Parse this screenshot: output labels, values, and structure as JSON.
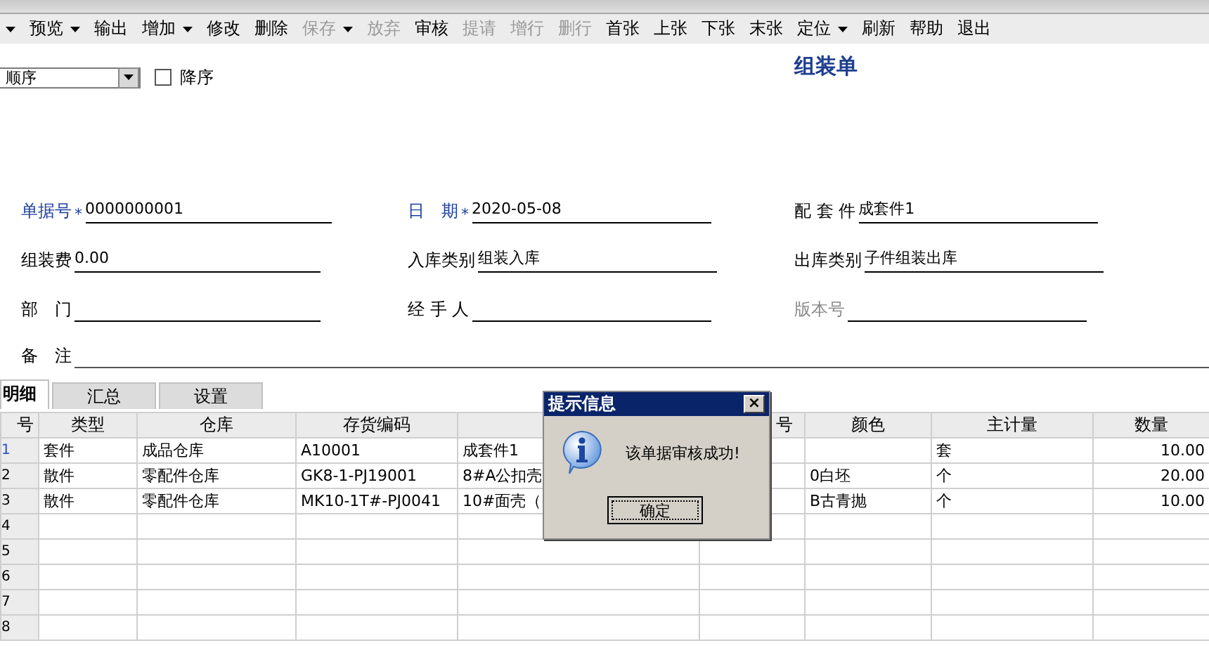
{
  "toolbar": [
    {
      "dropdown": true,
      "disabled": false
    },
    {
      "label": "预览",
      "dropdown": true,
      "disabled": false
    },
    {
      "label": "输出",
      "dropdown": false,
      "disabled": false
    },
    {
      "label": "增加",
      "dropdown": true,
      "disabled": false
    },
    {
      "label": "修改",
      "dropdown": false,
      "disabled": false
    },
    {
      "label": "删除",
      "dropdown": false,
      "disabled": false
    },
    {
      "label": "保存",
      "dropdown": true,
      "disabled": true
    },
    {
      "label": "放弃",
      "dropdown": false,
      "disabled": true
    },
    {
      "label": "审核",
      "dropdown": false,
      "disabled": false
    },
    {
      "label": "提请",
      "dropdown": false,
      "disabled": true
    },
    {
      "label": "增行",
      "dropdown": false,
      "disabled": true
    },
    {
      "label": "删行",
      "dropdown": false,
      "disabled": true
    },
    {
      "label": "首张",
      "dropdown": false,
      "disabled": false
    },
    {
      "label": "上张",
      "dropdown": false,
      "disabled": false
    },
    {
      "label": "下张",
      "dropdown": false,
      "disabled": false
    },
    {
      "label": "末张",
      "dropdown": false,
      "disabled": false
    },
    {
      "label": "定位",
      "dropdown": true,
      "disabled": false
    },
    {
      "label": "刷新",
      "dropdown": false,
      "disabled": false
    },
    {
      "label": "帮助",
      "dropdown": false,
      "disabled": false
    },
    {
      "label": "退出",
      "dropdown": false,
      "disabled": false
    }
  ],
  "sort": {
    "value": "顺序",
    "descending_label": "降序",
    "descending": false
  },
  "title": "组装单",
  "fields": [
    {
      "label": "单据号",
      "required_mark": "*",
      "value": "0000000001",
      "kind": "key",
      "disabled": false
    },
    {
      "label": "日　期",
      "required_mark": "*",
      "value": "2020-05-08",
      "kind": "key",
      "disabled": false
    },
    {
      "label": "配 套 件",
      "value": "成套件1",
      "kind": "plain",
      "disabled": false
    },
    {
      "label": "组装费",
      "value": "0.00",
      "kind": "plain",
      "disabled": false
    },
    {
      "label": "入库类别",
      "value": "组装入库",
      "kind": "plain",
      "disabled": false
    },
    {
      "label": "出库类别",
      "value": "子件组装出库",
      "kind": "plain",
      "disabled": false
    },
    {
      "label": "部　门",
      "kind": "plain",
      "disabled": false
    },
    {
      "label": "经 手 人",
      "kind": "plain",
      "disabled": false
    },
    {
      "label": "版本号",
      "kind": "plain",
      "disabled": true
    }
  ],
  "remark": {
    "label": "备　注"
  },
  "tabs": [
    {
      "label": "明细",
      "selected": true
    },
    {
      "label": "汇总",
      "selected": false
    },
    {
      "label": "设置",
      "selected": false
    }
  ],
  "table": {
    "columns": [
      "号",
      "类型",
      "仓库",
      "存货编码",
      null,
      "号",
      "颜色",
      "主计量",
      "数量"
    ],
    "rows": [
      {
        "current": true,
        "cells": [
          "1",
          "套件",
          "成品仓库",
          "A10001",
          "成套件1",
          null,
          null,
          "套",
          "10.00"
        ]
      },
      {
        "current": false,
        "cells": [
          "2",
          "散件",
          "零配件仓库",
          "GK8-1-PJ19001",
          "8#A公扣壳",
          null,
          "0白坯",
          "个",
          "20.00"
        ]
      },
      {
        "current": false,
        "cells": [
          "3",
          "散件",
          "零配件仓库",
          "MK10-1T#-PJ0041",
          "10#面壳（",
          null,
          "B古青抛",
          "个",
          "10.00"
        ]
      },
      {
        "current": false,
        "cells": [
          "4",
          null,
          null,
          null,
          null,
          null,
          null,
          null,
          null
        ]
      },
      {
        "current": false,
        "cells": [
          "5",
          null,
          null,
          null,
          null,
          null,
          null,
          null,
          null
        ]
      },
      {
        "current": false,
        "cells": [
          "6",
          null,
          null,
          null,
          null,
          null,
          null,
          null,
          null
        ]
      },
      {
        "current": false,
        "cells": [
          "7",
          null,
          null,
          null,
          null,
          null,
          null,
          null,
          null
        ]
      },
      {
        "current": false,
        "cells": [
          "8",
          null,
          null,
          null,
          null,
          null,
          null,
          null,
          null
        ]
      }
    ]
  },
  "dialog": {
    "title": "提示信息",
    "close": "×",
    "message": "该单据审核成功!",
    "button": "确定"
  }
}
